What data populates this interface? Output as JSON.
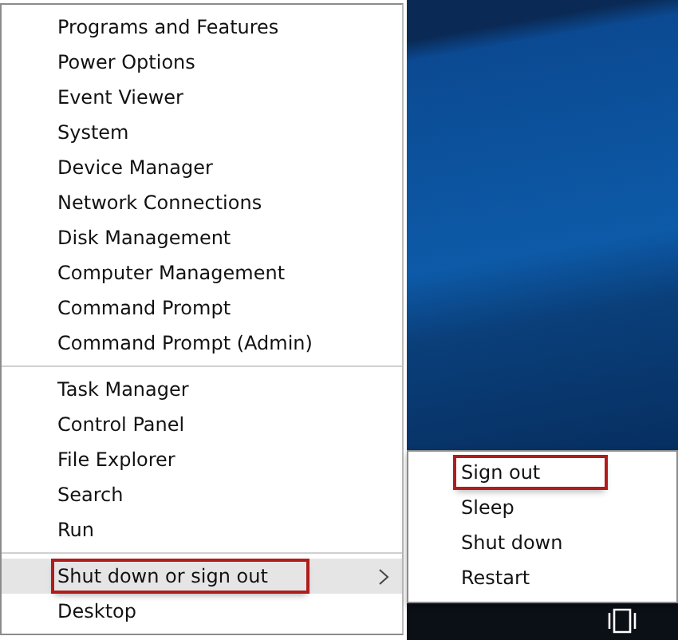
{
  "menu": {
    "groups": [
      {
        "items": [
          {
            "label": "Programs and Features",
            "kind": "command",
            "selected": false,
            "annotated": false
          },
          {
            "label": "Power Options",
            "kind": "command",
            "selected": false,
            "annotated": false
          },
          {
            "label": "Event Viewer",
            "kind": "command",
            "selected": false,
            "annotated": false
          },
          {
            "label": "System",
            "kind": "command",
            "selected": false,
            "annotated": false
          },
          {
            "label": "Device Manager",
            "kind": "command",
            "selected": false,
            "annotated": false
          },
          {
            "label": "Network Connections",
            "kind": "command",
            "selected": false,
            "annotated": false
          },
          {
            "label": "Disk Management",
            "kind": "command",
            "selected": false,
            "annotated": false
          },
          {
            "label": "Computer Management",
            "kind": "command",
            "selected": false,
            "annotated": false
          },
          {
            "label": "Command Prompt",
            "kind": "command",
            "selected": false,
            "annotated": false
          },
          {
            "label": "Command Prompt (Admin)",
            "kind": "command",
            "selected": false,
            "annotated": false
          }
        ]
      },
      {
        "items": [
          {
            "label": "Task Manager",
            "kind": "command",
            "selected": false,
            "annotated": false
          },
          {
            "label": "Control Panel",
            "kind": "command",
            "selected": false,
            "annotated": false
          },
          {
            "label": "File Explorer",
            "kind": "command",
            "selected": false,
            "annotated": false
          },
          {
            "label": "Search",
            "kind": "command",
            "selected": false,
            "annotated": false
          },
          {
            "label": "Run",
            "kind": "command",
            "selected": false,
            "annotated": false
          }
        ]
      },
      {
        "items": [
          {
            "label": "Shut down or sign out",
            "kind": "submenu",
            "selected": true,
            "annotated": true
          },
          {
            "label": "Desktop",
            "kind": "command",
            "selected": false,
            "annotated": false
          }
        ]
      }
    ]
  },
  "submenu": {
    "items": [
      {
        "label": "Sign out",
        "annotated": true
      },
      {
        "label": "Sleep",
        "annotated": false
      },
      {
        "label": "Shut down",
        "annotated": false
      },
      {
        "label": "Restart",
        "annotated": false
      }
    ]
  }
}
